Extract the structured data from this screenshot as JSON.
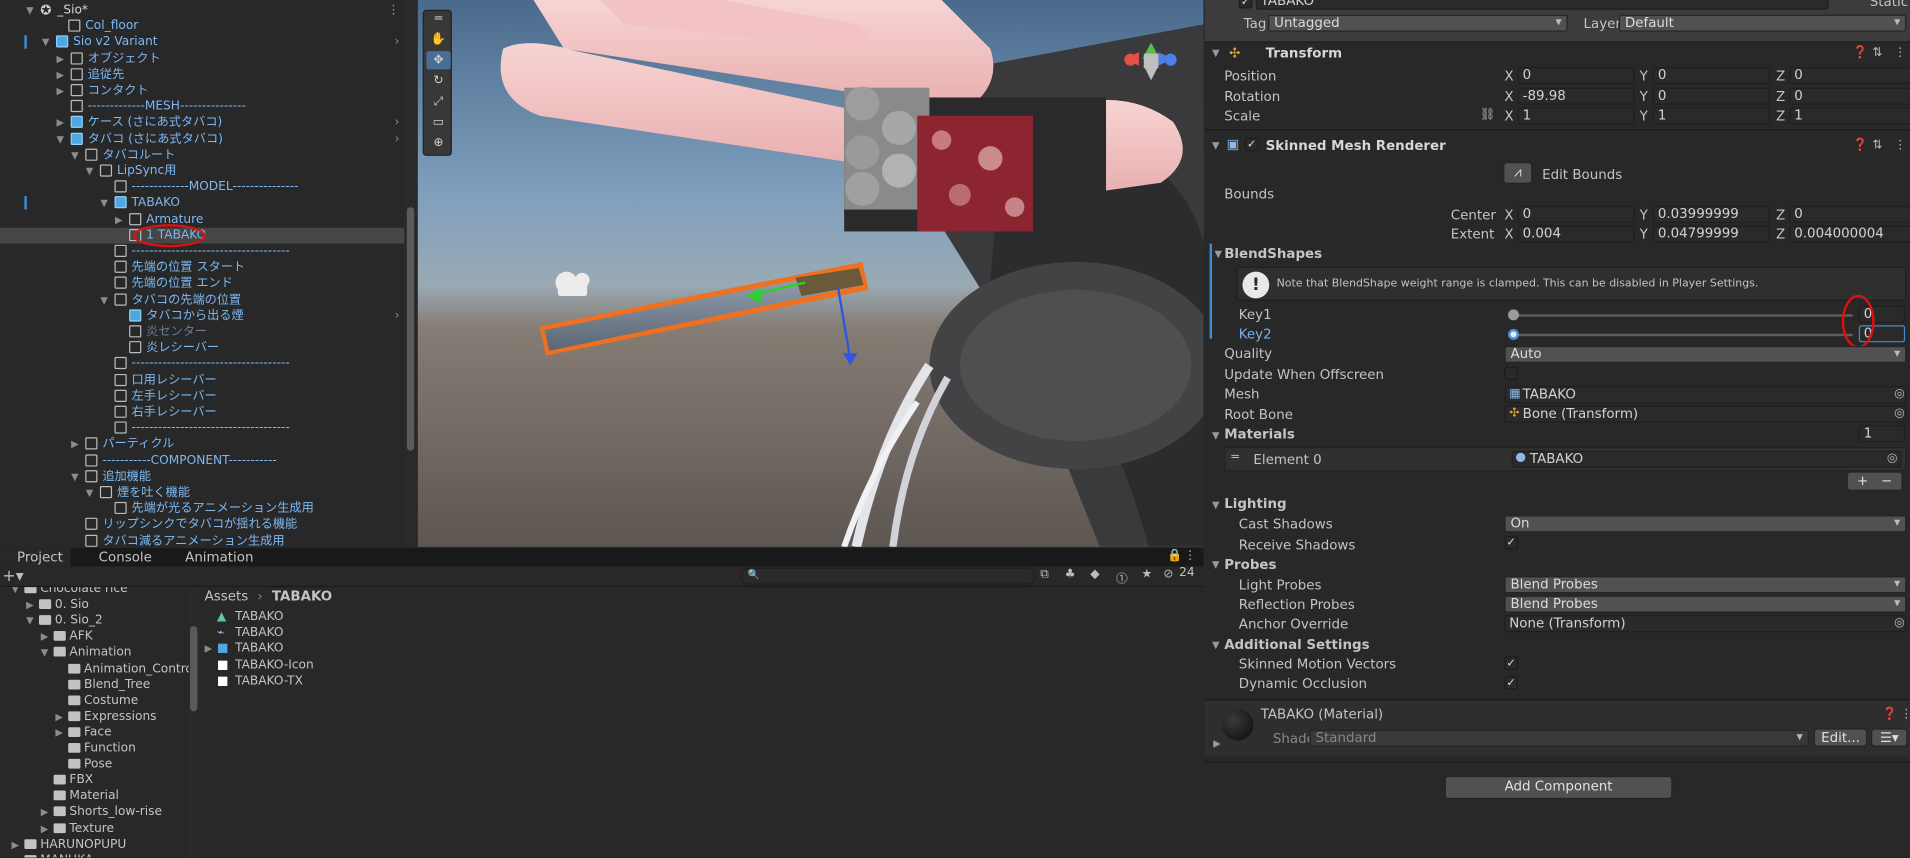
{
  "hierarchy": {
    "scene_name": "_Sio*",
    "rows": [
      {
        "label": "Col_floor"
      },
      {
        "label": "Sio v2 Variant"
      },
      {
        "label": "オブジェクト"
      },
      {
        "label": "追従先"
      },
      {
        "label": "コンタクト"
      },
      {
        "label": "-------------MESH---------------"
      },
      {
        "label": "ケース (さにあ式タバコ)"
      },
      {
        "label": "タバコ (さにあ式タバコ)"
      },
      {
        "label": "タバコルート"
      },
      {
        "label": "LipSync用"
      },
      {
        "label": "-------------MODEL---------------"
      },
      {
        "label": "TABAKO"
      },
      {
        "label": "Armature"
      },
      {
        "label": "1 TABAKO"
      },
      {
        "label": "------------------------------------"
      },
      {
        "label": "先端の位置 スタート"
      },
      {
        "label": "先端の位置 エンド"
      },
      {
        "label": "タバコの先端の位置"
      },
      {
        "label": "タバコから出る煙"
      },
      {
        "label": "炎センター"
      },
      {
        "label": "炎レシーバー"
      },
      {
        "label": "------------------------------------"
      },
      {
        "label": "口用レシーバー"
      },
      {
        "label": "左手レシーバー"
      },
      {
        "label": "右手レシーバー"
      },
      {
        "label": "------------------------------------"
      },
      {
        "label": "パーティクル"
      },
      {
        "label": "-----------COMPONENT-----------"
      },
      {
        "label": "追加機能"
      },
      {
        "label": "煙を吐く機能"
      },
      {
        "label": "先端が光るアニメーション生成用"
      },
      {
        "label": "リップシンクでタバコが揺れる機能"
      },
      {
        "label": "タバコ減るアニメーション生成用"
      }
    ]
  },
  "bottom": {
    "tabs": [
      "Project",
      "Console",
      "Animation"
    ],
    "hidden_count": "24",
    "breadcrumb": [
      "Assets",
      "TABAKO"
    ],
    "tree": [
      {
        "label": "Chocolate rice"
      },
      {
        "label": "0. Sio"
      },
      {
        "label": "0. Sio_2"
      },
      {
        "label": "AFK"
      },
      {
        "label": "Animation"
      },
      {
        "label": "Animation_Control"
      },
      {
        "label": "Blend_Tree"
      },
      {
        "label": "Costume"
      },
      {
        "label": "Expressions"
      },
      {
        "label": "Face"
      },
      {
        "label": "Function"
      },
      {
        "label": "Pose"
      },
      {
        "label": "FBX"
      },
      {
        "label": "Material"
      },
      {
        "label": "Shorts_low-rise"
      },
      {
        "label": "Texture"
      },
      {
        "label": "HARUNOPUPU"
      },
      {
        "label": "MANUKA"
      }
    ],
    "assets": [
      "TABAKO",
      "TABAKO",
      "TABAKO",
      "TABAKO-Icon",
      "TABAKO-TX"
    ]
  },
  "inspector": {
    "object_name": "TABAKO",
    "static_label": "Static",
    "tag_label": "Tag",
    "tag_value": "Untagged",
    "layer_label": "Layer",
    "layer_value": "Default",
    "transform": {
      "title": "Transform",
      "position_label": "Position",
      "position": [
        "0",
        "0",
        "0"
      ],
      "rotation_label": "Rotation",
      "rotation": [
        "-89.98",
        "0",
        "0"
      ],
      "scale_label": "Scale",
      "scale": [
        "1",
        "1",
        "1"
      ]
    },
    "smr": {
      "title": "Skinned Mesh Renderer",
      "edit_bounds": "Edit Bounds",
      "bounds_label": "Bounds",
      "center_label": "Center",
      "center": [
        "0",
        "0.03999999",
        "0"
      ],
      "extent_label": "Extent",
      "extent": [
        "0.004",
        "0.04799999",
        "0.004000004"
      ],
      "blendshapes_label": "BlendShapes",
      "note": "Note that BlendShape weight range is clamped. This can be disabled in Player Settings.",
      "key1_label": "Key1",
      "key1_value": "0",
      "key1_fraction": 0,
      "key2_label": "Key2",
      "key2_value": "0",
      "key2_fraction": 0,
      "quality_label": "Quality",
      "quality_value": "Auto",
      "update_offscreen_label": "Update When Offscreen",
      "mesh_label": "Mesh",
      "mesh_value": "TABAKO",
      "root_bone_label": "Root Bone",
      "root_bone_value": "Bone (Transform)",
      "materials_label": "Materials",
      "materials_count": "1",
      "element0_label": "Element 0",
      "element0_value": "TABAKO",
      "lighting_label": "Lighting",
      "cast_shadows_label": "Cast Shadows",
      "cast_shadows_value": "On",
      "receive_shadows_label": "Receive Shadows",
      "probes_label": "Probes",
      "light_probes_label": "Light Probes",
      "light_probes_value": "Blend Probes",
      "reflection_probes_label": "Reflection Probes",
      "reflection_probes_value": "Blend Probes",
      "anchor_override_label": "Anchor Override",
      "anchor_override_value": "None (Transform)",
      "additional_label": "Additional Settings",
      "motion_vectors_label": "Skinned Motion Vectors",
      "dynamic_occlusion_label": "Dynamic Occlusion"
    },
    "material": {
      "name": "TABAKO (Material)",
      "shader_label": "Shader",
      "shader_value": "Standard",
      "edit_label": "Edit..."
    },
    "add_component": "Add Component"
  },
  "colors": {
    "accent": "#3d8bd9",
    "highlight_circle": "#e01010",
    "label_blue": "#7cb8f2"
  }
}
